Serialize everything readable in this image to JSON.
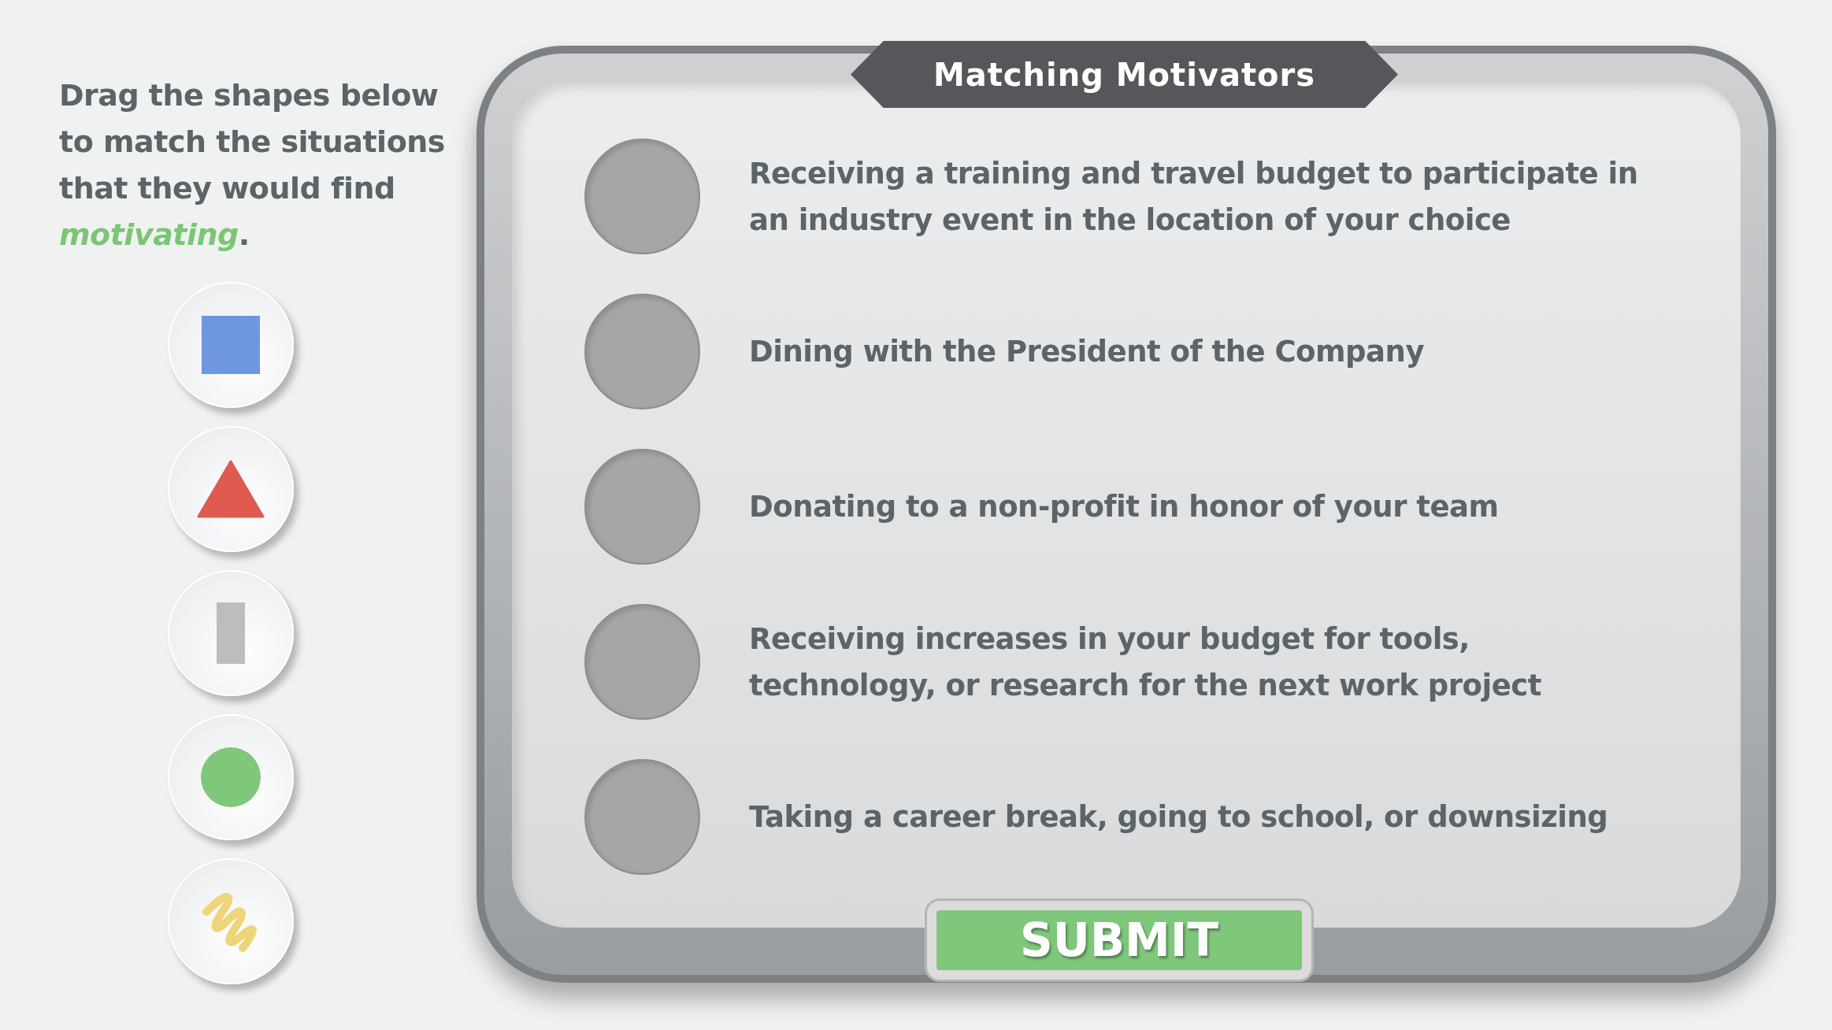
{
  "instruction": "Drag the shapes below to match the situations that they would find *motivating*.",
  "shapes": [
    {
      "kind": "square"
    },
    {
      "kind": "triangle"
    },
    {
      "kind": "bar"
    },
    {
      "kind": "circle"
    },
    {
      "kind": "scribble"
    }
  ],
  "board": {
    "title": "Matching Motivators",
    "situations": [
      {
        "text": "Receiving a training and travel budget to participate in an industry event in the location of your choice"
      },
      {
        "text": "Dining with the President of the Company"
      },
      {
        "text": "Donating to a non-profit in honor of your team"
      },
      {
        "text": "Receiving increases in your budget for tools, technology, or research for the next work project"
      },
      {
        "text": "Taking a career break, going to school, or downsizing"
      }
    ],
    "submit": "SUBMIT"
  }
}
